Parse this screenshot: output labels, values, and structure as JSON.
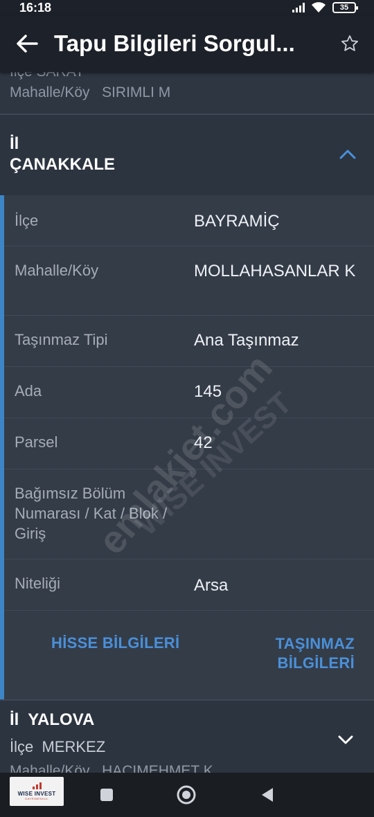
{
  "status_bar": {
    "time": "16:18",
    "battery": "35"
  },
  "app_bar": {
    "title": "Tapu Bilgileri Sorgul..."
  },
  "previous_record": {
    "partial_text": "İlçe  SARAY",
    "mahalle_label": "Mahalle/Köy",
    "mahalle_value": "SIRIMLI M"
  },
  "current_record": {
    "il_label": "İl",
    "il_value": "ÇANAKKALE",
    "details": [
      {
        "label": "İlçe",
        "value": "BAYRAMİÇ"
      },
      {
        "label": "Mahalle/Köy",
        "value": "MOLLAHASANLAR K"
      },
      {
        "label": "Taşınmaz Tipi",
        "value": "Ana Taşınmaz"
      },
      {
        "label": "Ada",
        "value": "145"
      },
      {
        "label": "Parsel",
        "value": "42"
      },
      {
        "label": "Bağımsız Bölüm Numarası / Kat / Blok / Giriş",
        "value": ""
      },
      {
        "label": "Niteliği",
        "value": "Arsa"
      }
    ],
    "actions": {
      "hisse": "HİSSE BİLGİLERİ",
      "tasinmaz": "TAŞINMAZ BİLGİLERİ"
    }
  },
  "next_record": {
    "il_label": "İl",
    "il_value": "YALOVA",
    "ilce_label": "İlçe",
    "ilce_value": "MERKEZ",
    "mahalle_label": "Mahalle/Köy",
    "mahalle_value": "HACIMEHMET K"
  },
  "watermark": {
    "logo_line1": "WISE INVEST",
    "logo_line2": "GAYRIMENKUL",
    "site_text": "emlakjet.com",
    "brand_text": "WISE INVEST"
  },
  "colors": {
    "accent": "#3d85c6",
    "action_text": "#4a90d9",
    "app_bar": "#1d2129",
    "background": "#2c3440",
    "panel": "#343c48"
  }
}
